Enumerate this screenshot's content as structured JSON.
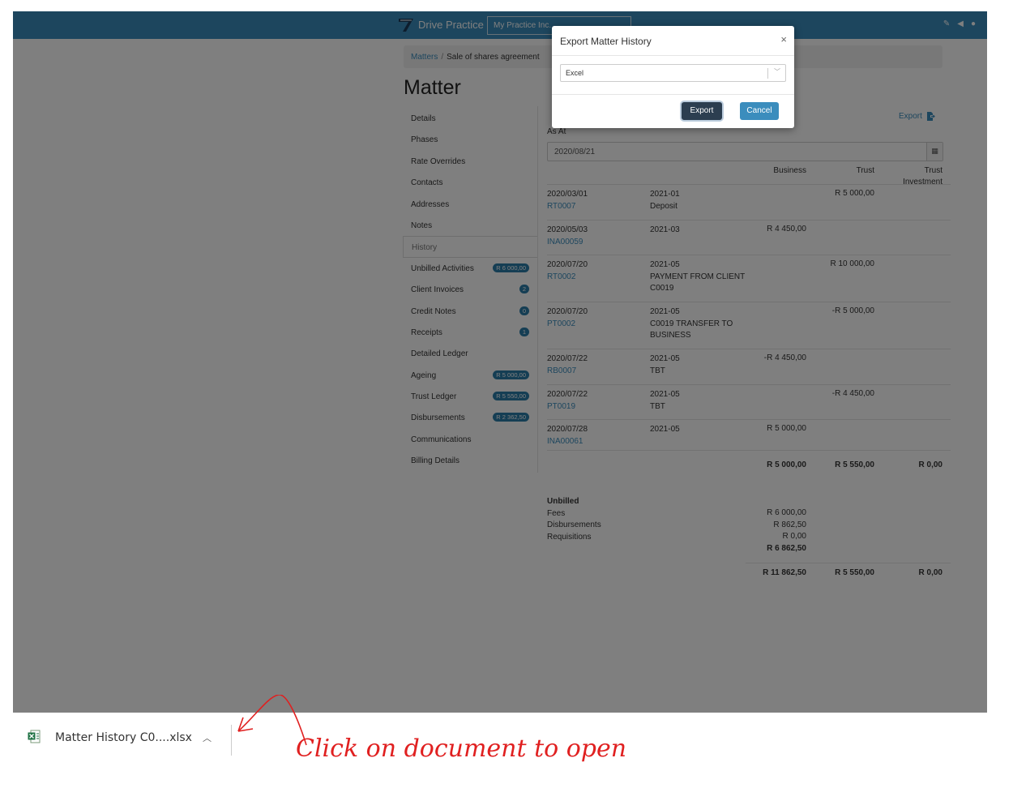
{
  "navbar": {
    "brand": "Drive Practice",
    "practice_select": "My Practice Inc.",
    "icons": [
      "wand-icon",
      "megaphone-icon",
      "user-icon"
    ]
  },
  "breadcrumb": {
    "root": "Matters",
    "current": "Sale of shares agreement"
  },
  "page_title": "Matter",
  "side_nav": [
    {
      "label": "Details"
    },
    {
      "label": "Phases"
    },
    {
      "label": "Rate Overrides"
    },
    {
      "label": "Contacts"
    },
    {
      "label": "Addresses"
    },
    {
      "label": "Notes"
    },
    {
      "label": "History",
      "active": true
    },
    {
      "label": "Unbilled Activities",
      "badge": "R 6 000,00"
    },
    {
      "label": "Client Invoices",
      "badge": "2"
    },
    {
      "label": "Credit Notes",
      "badge": "0"
    },
    {
      "label": "Receipts",
      "badge": "1"
    },
    {
      "label": "Detailed Ledger"
    },
    {
      "label": "Ageing",
      "badge": "R 5 000,00"
    },
    {
      "label": "Trust Ledger",
      "badge": "R 5 550,00"
    },
    {
      "label": "Disbursements",
      "badge": "R 2 362,50"
    },
    {
      "label": "Communications"
    },
    {
      "label": "Billing Details"
    }
  ],
  "history": {
    "export_label": "Export",
    "as_at_label": "As At",
    "as_at_value": "2020/08/21",
    "columns": {
      "business": "Business",
      "trust": "Trust",
      "trust_investment_1": "Trust",
      "trust_investment_2": "Investment"
    },
    "rows": [
      {
        "date": "2020/03/01",
        "ref": "RT0007",
        "period": "2021-01",
        "desc": "Deposit",
        "business": "",
        "trust": "R 5 000,00"
      },
      {
        "date": "2020/05/03",
        "ref": "INA00059",
        "period": "2021-03",
        "desc": "",
        "business": "R 4 450,00",
        "trust": ""
      },
      {
        "date": "2020/07/20",
        "ref": "RT0002",
        "period": "2021-05",
        "desc": "PAYMENT FROM CLIENT C0019",
        "business": "",
        "trust": "R 10 000,00"
      },
      {
        "date": "2020/07/20",
        "ref": "PT0002",
        "period": "2021-05",
        "desc": "C0019 TRANSFER TO BUSINESS",
        "business": "",
        "trust": "-R 5 000,00"
      },
      {
        "date": "2020/07/22",
        "ref": "RB0007",
        "period": "2021-05",
        "desc": "TBT",
        "business": "-R 4 450,00",
        "trust": ""
      },
      {
        "date": "2020/07/22",
        "ref": "PT0019",
        "period": "2021-05",
        "desc": "TBT",
        "business": "",
        "trust": "-R 4 450,00"
      },
      {
        "date": "2020/07/28",
        "ref": "INA00061",
        "period": "2021-05",
        "desc": "",
        "business": "R 5 000,00",
        "trust": ""
      }
    ],
    "totals": {
      "business": "R 5 000,00",
      "trust": "R 5 550,00",
      "trust_investment": "R 0,00"
    },
    "unbilled": {
      "heading": "Unbilled",
      "fees_label": "Fees",
      "fees": "R 6 000,00",
      "disb_label": "Disbursements",
      "disb": "R 862,50",
      "req_label": "Requisitions",
      "req": "R 0,00",
      "total": "R 6 862,50"
    },
    "grand_totals": {
      "business": "R 11 862,50",
      "trust": "R 5 550,00",
      "trust_investment": "R 0,00"
    }
  },
  "modal": {
    "title": "Export Matter History",
    "close": "×",
    "format_value": "Excel",
    "export_button": "Export",
    "cancel_button": "Cancel"
  },
  "download_bar": {
    "file_name": "Matter History C0....xlsx",
    "annotation": "Click on document to open",
    "annotation_color": "#e02020"
  }
}
